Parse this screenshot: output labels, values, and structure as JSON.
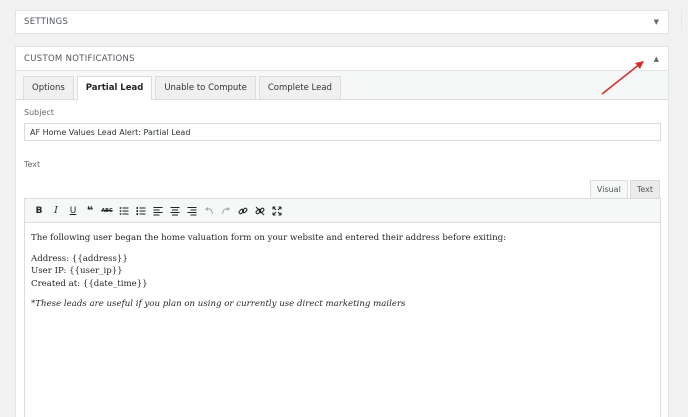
{
  "settings_panel": {
    "title": "SETTINGS",
    "toggle": "▼"
  },
  "notifications_panel": {
    "title": "CUSTOM NOTIFICATIONS",
    "toggle": "▲",
    "tabs": [
      "Options",
      "Partial Lead",
      "Unable to Compute",
      "Complete Lead"
    ],
    "active_tab": "Partial Lead"
  },
  "subject": {
    "label": "Subject",
    "value": "AF Home Values Lead Alert: Partial Lead"
  },
  "text": {
    "label": "Text"
  },
  "editor": {
    "modes": [
      "Visual",
      "Text"
    ],
    "active_mode": "Visual",
    "toolbar": [
      "B",
      "I",
      "U",
      "❝",
      "ABC"
    ],
    "paragraphs": [
      "The following user began the home valuation form on your website and entered their address before exiting:",
      "Address: {{address}}",
      "User IP: {{user_ip}}",
      "Created at: {{date_time}}",
      "*These leads are useful if you plan on using or currently use direct marketing mailers"
    ]
  },
  "colors": {
    "arrow": "#d32f2f"
  }
}
